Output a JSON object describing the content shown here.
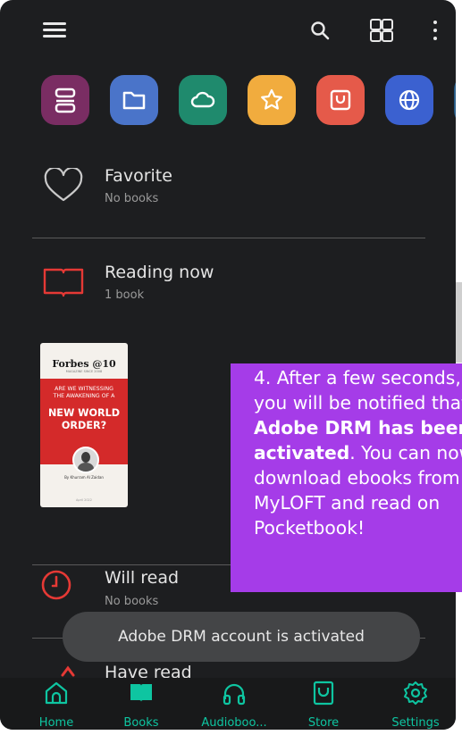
{
  "topbar": {
    "menu_icon": "hamburger-menu-icon",
    "search_icon": "search-icon",
    "grid_icon": "grid-view-icon",
    "more_icon": "more-vertical-icon"
  },
  "categories": [
    {
      "icon": "library-shelves-icon",
      "color": "#7a2d63"
    },
    {
      "icon": "folder-icon",
      "color": "#4a74c9"
    },
    {
      "icon": "cloud-icon",
      "color": "#1f8a6d"
    },
    {
      "icon": "star-icon",
      "color": "#f1ac3e"
    },
    {
      "icon": "store-bag-icon",
      "color": "#e55a4a"
    },
    {
      "icon": "globe-icon",
      "color": "#3b61d0"
    }
  ],
  "sections": {
    "favorite": {
      "title": "Favorite",
      "subtitle": "No books"
    },
    "reading_now": {
      "title": "Reading now",
      "subtitle": "1 book"
    },
    "will_read": {
      "title": "Will read",
      "subtitle": "No books"
    },
    "have_read": {
      "title": "Have read"
    }
  },
  "book": {
    "brand": "Forbes @10",
    "tagline": "MAGAZINE SINCE 2008",
    "line1": "ARE WE WITNESSING",
    "line2": "THE AWAKENING OF A",
    "headline1": "NEW WORLD",
    "headline2": "ORDER?",
    "author": "By Khurram Al Zaidan",
    "footer": "April 2022"
  },
  "tooltip": {
    "part1": "4. After a few seconds,",
    "part2": "you will be notified that",
    "bold1": "Adobe DRM has been",
    "bold2": "activated",
    "part3": ". You can now",
    "part4": "download ebooks from",
    "part5": "MyLOFT and read on",
    "part6": "Pocketbook!"
  },
  "toast": {
    "message": "Adobe DRM account is activated"
  },
  "bottom_nav": [
    {
      "label": "Home",
      "icon": "home-icon"
    },
    {
      "label": "Books",
      "icon": "open-book-icon"
    },
    {
      "label": "Audioboo...",
      "icon": "headphones-icon"
    },
    {
      "label": "Store",
      "icon": "store-bag-icon"
    },
    {
      "label": "Settings",
      "icon": "gear-icon"
    }
  ],
  "colors": {
    "accent": "#0ec5a1",
    "tooltip": "#a53ce8",
    "heart": "#c9c9c9",
    "reading_icon": "#e53935"
  }
}
